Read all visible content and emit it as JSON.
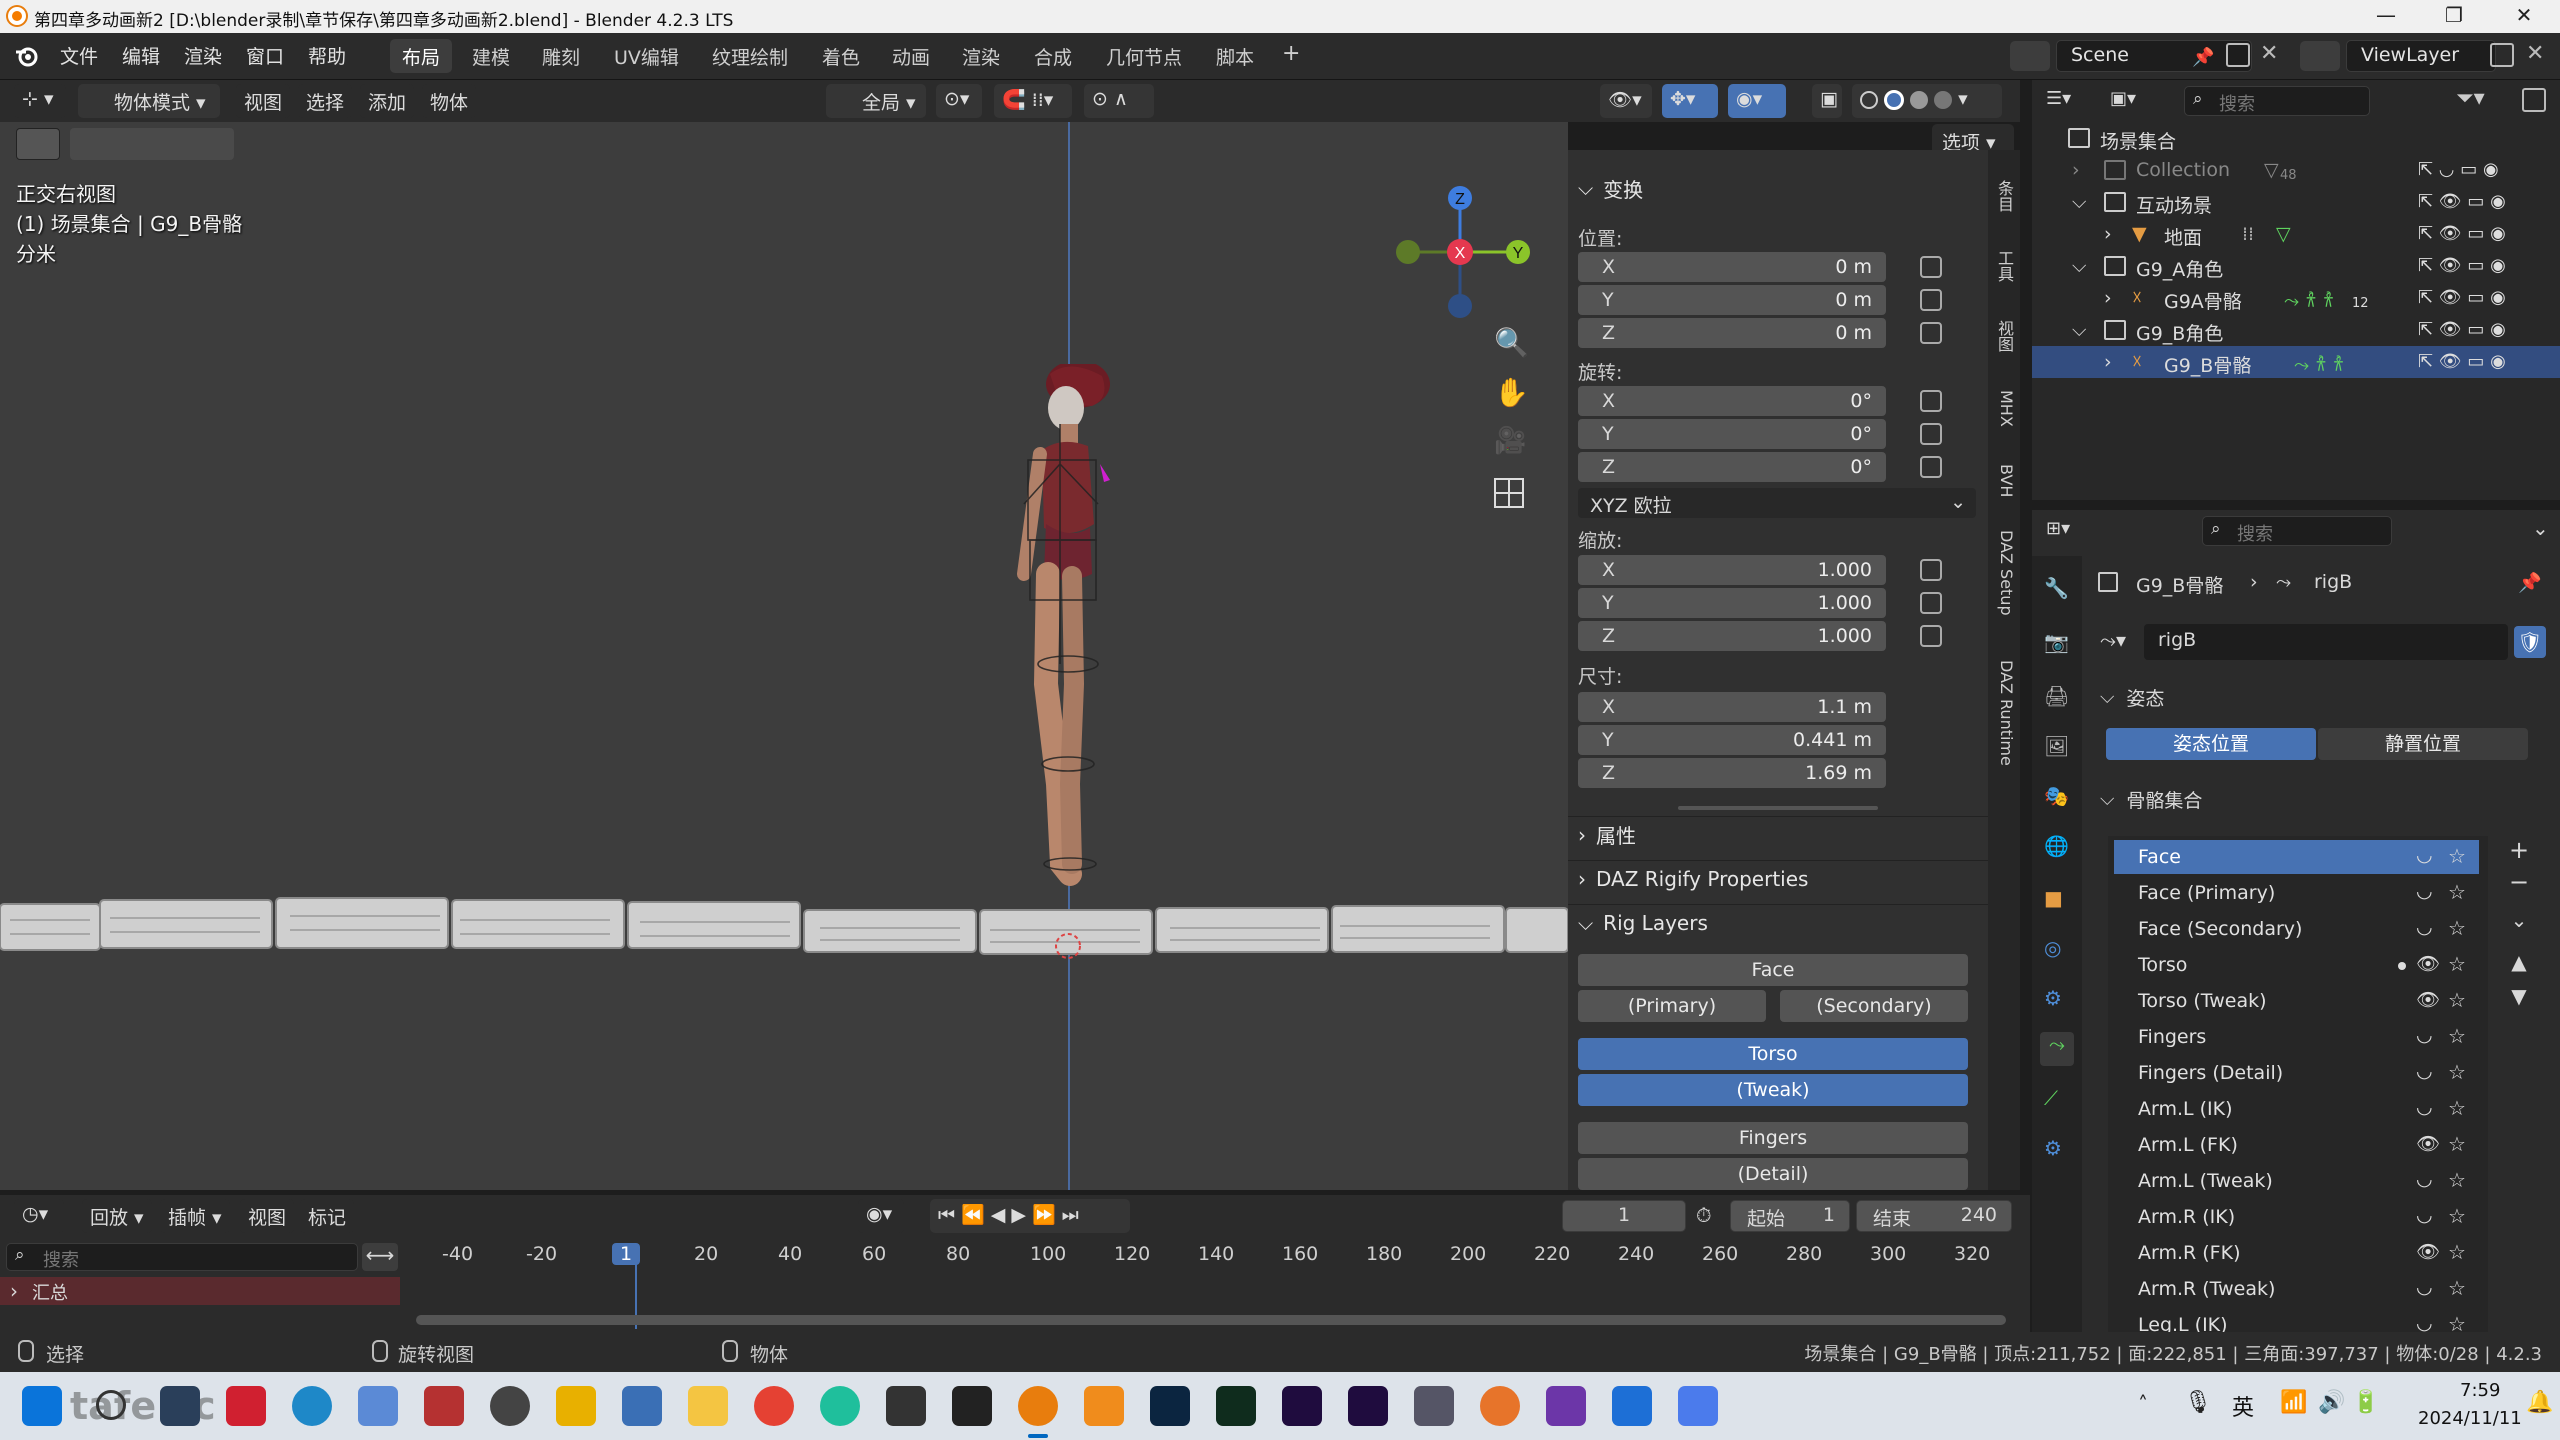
{
  "window": {
    "title": "第四章多动画新2 [D:\\blender录制\\章节保存\\第四章多动画新2.blend] - Blender 4.2.3 LTS",
    "minimize": "—",
    "maximize": "❐",
    "close": "✕"
  },
  "menu": [
    "文件",
    "编辑",
    "渲染",
    "窗口",
    "帮助"
  ],
  "workspaces": [
    "布局",
    "建模",
    "雕刻",
    "UV编辑",
    "纹理绘制",
    "着色",
    "动画",
    "渲染",
    "合成",
    "几何节点",
    "脚本",
    "+"
  ],
  "scene": {
    "name": "Scene",
    "viewlayer": "ViewLayer"
  },
  "viewport_header": {
    "mode": "物体模式",
    "view": "视图",
    "select": "选择",
    "add": "添加",
    "object": "物体",
    "orientation": "全局",
    "options": "选项"
  },
  "viewport_info": {
    "view": "正交右视图",
    "collection": "(1) 场景集合 | G9_B骨骼",
    "units": "分米"
  },
  "npanel": {
    "transform": "变换",
    "location_label": "位置:",
    "location": [
      {
        "axis": "X",
        "value": "0 m"
      },
      {
        "axis": "Y",
        "value": "0 m"
      },
      {
        "axis": "Z",
        "value": "0 m"
      }
    ],
    "rotation_label": "旋转:",
    "rotation": [
      {
        "axis": "X",
        "value": "0°"
      },
      {
        "axis": "Y",
        "value": "0°"
      },
      {
        "axis": "Z",
        "value": "0°"
      }
    ],
    "rotation_mode": "XYZ 欧拉",
    "scale_label": "缩放:",
    "scale": [
      {
        "axis": "X",
        "value": "1.000"
      },
      {
        "axis": "Y",
        "value": "1.000"
      },
      {
        "axis": "Z",
        "value": "1.000"
      }
    ],
    "dimensions_label": "尺寸:",
    "dimensions": [
      {
        "axis": "X",
        "value": "1.1 m"
      },
      {
        "axis": "Y",
        "value": "0.441 m"
      },
      {
        "axis": "Z",
        "value": "1.69 m"
      }
    ],
    "properties": "属性",
    "daz_rigify": "DAZ Rigify Properties",
    "rig_layers": "Rig Layers",
    "rig_buttons": {
      "face": "Face",
      "primary": "(Primary)",
      "secondary": "(Secondary)",
      "torso": "Torso",
      "tweak": "(Tweak)",
      "fingers": "Fingers",
      "detail": "(Detail)"
    }
  },
  "sidebar_tabs": [
    "条目",
    "工具",
    "视图",
    "MHX",
    "BVH",
    "DAZ Setup",
    "DAZ Runtime"
  ],
  "outliner": {
    "search_placeholder": "搜索",
    "root": "场景集合",
    "rows": [
      {
        "name": "Collection",
        "badge": "48"
      },
      {
        "name": "互动场景"
      },
      {
        "name": "地面"
      },
      {
        "name": "G9_A角色"
      },
      {
        "name": "G9A骨骼",
        "badge": "12"
      },
      {
        "name": "G9_B角色"
      },
      {
        "name": "G9_B骨骼"
      }
    ]
  },
  "properties": {
    "search_placeholder": "搜索",
    "breadcrumb_object": "G9_B骨骼",
    "breadcrumb_data": "rigB",
    "data_name": "rigB",
    "pose_section": "姿态",
    "pose_position": "姿态位置",
    "rest_position": "静置位置",
    "bone_collections": "骨骼集合",
    "bone_list": [
      {
        "name": "Face",
        "visible": false,
        "selected": true
      },
      {
        "name": "Face (Primary)",
        "visible": false
      },
      {
        "name": "Face (Secondary)",
        "visible": false
      },
      {
        "name": "Torso",
        "visible": true,
        "dot": true
      },
      {
        "name": "Torso (Tweak)",
        "visible": true
      },
      {
        "name": "Fingers",
        "visible": false
      },
      {
        "name": "Fingers (Detail)",
        "visible": false
      },
      {
        "name": "Arm.L (IK)",
        "visible": false
      },
      {
        "name": "Arm.L (FK)",
        "visible": true
      },
      {
        "name": "Arm.L (Tweak)",
        "visible": false
      },
      {
        "name": "Arm.R (IK)",
        "visible": false
      },
      {
        "name": "Arm.R (FK)",
        "visible": true
      },
      {
        "name": "Arm.R (Tweak)",
        "visible": false
      },
      {
        "name": "Leg.L (IK)",
        "visible": false
      }
    ]
  },
  "timeline": {
    "playback": "回放",
    "keying": "插帧",
    "view": "视图",
    "marker": "标记",
    "current_frame": "1",
    "start_label": "起始",
    "start": "1",
    "end_label": "结束",
    "end": "240",
    "search_placeholder": "搜索",
    "summary": "汇总",
    "ticks": [
      "-40",
      "-20",
      "1",
      "20",
      "40",
      "60",
      "80",
      "100",
      "120",
      "140",
      "160",
      "180",
      "200",
      "220",
      "240",
      "260",
      "280",
      "300",
      "320"
    ]
  },
  "statusbar": {
    "select": "选择",
    "rotate": "旋转视图",
    "object": "物体",
    "stats": "场景集合 | G9_B骨骼 | 顶点:211,752 | 面:222,851 | 三角面:397,737 | 物体:0/28 | 4.2.3"
  },
  "taskbar": {
    "ime": "英",
    "time": "7:59",
    "date": "2024/11/11",
    "watermark": "tafe.cc"
  },
  "colors": {
    "accent": "#4772b3",
    "x_axis": "#e5384f",
    "y_axis": "#8bc42a",
    "z_axis": "#3e7de0"
  }
}
